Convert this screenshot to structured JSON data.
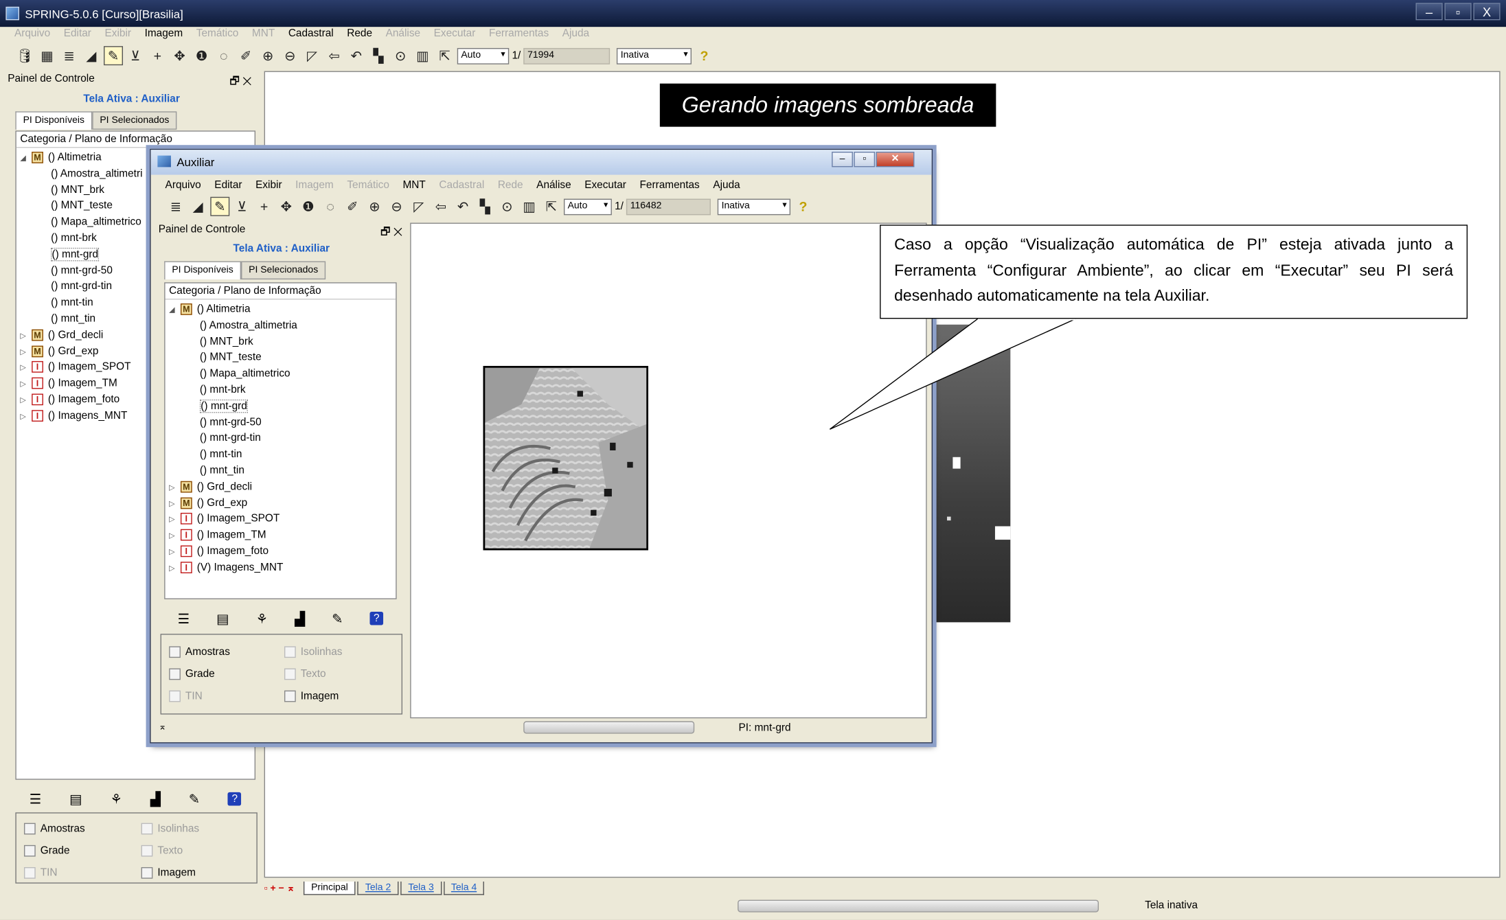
{
  "main": {
    "title": "SPRING-5.0.6 [Curso][Brasilia]",
    "window_buttons": [
      "–",
      "▫",
      "X"
    ],
    "menu": [
      "Arquivo",
      "Editar",
      "Exibir",
      "Imagem",
      "Temático",
      "MNT",
      "Cadastral",
      "Rede",
      "Análise",
      "Executar",
      "Ferramentas",
      "Ajuda"
    ],
    "menu_enabled": [
      false,
      false,
      false,
      true,
      false,
      false,
      true,
      true,
      false,
      false,
      false,
      false
    ],
    "toolbar": {
      "zoom_mode": "Auto",
      "scale_prefix": "1/",
      "scale_value": "71994",
      "state": "Inativa",
      "help": "?"
    },
    "panel": {
      "title": "Painel de Controle",
      "active": "Tela Ativa : Auxiliar",
      "tab_available": "PI Disponíveis",
      "tab_selected": "PI Selecionados",
      "tree_header": "Categoria / Plano de Informação"
    },
    "checks": {
      "amostras": "Amostras",
      "isolinhas": "Isolinhas",
      "grade": "Grade",
      "texto": "Texto",
      "tin": "TIN",
      "imagem": "Imagem"
    },
    "sheet_tabs": [
      "Principal",
      "Tela 2",
      "Tela 3",
      "Tela 4"
    ],
    "status": "Tela inativa"
  },
  "tree": {
    "altimetria": "() Altimetria",
    "children": [
      "() Amostra_altimetria",
      "() MNT_brk",
      "() MNT_teste",
      "() Mapa_altimetrico",
      "() mnt-brk",
      "() mnt-grd",
      "() mnt-grd-50",
      "() mnt-grd-tin",
      "() mnt-tin",
      "() mnt_tin"
    ],
    "main_children": [
      "() Amostra_altimetri",
      "() MNT_brk",
      "() MNT_teste",
      "() Mapa_altimetrico",
      "() mnt-brk",
      "() mnt-grd",
      "() mnt-grd-50",
      "() mnt-grd-tin",
      "() mnt-tin",
      "() mnt_tin"
    ],
    "categories": [
      {
        "badge": "M",
        "label": "() Grd_decli"
      },
      {
        "badge": "M",
        "label": "() Grd_exp"
      },
      {
        "badge": "I",
        "label": "() Imagem_SPOT"
      },
      {
        "badge": "I",
        "label": "() Imagem_TM"
      },
      {
        "badge": "I",
        "label": "() Imagem_foto"
      }
    ],
    "last_main": "() Imagens_MNT",
    "last_aux": "(V) Imagens_MNT"
  },
  "aux": {
    "title": "Auxiliar",
    "menu": [
      "Arquivo",
      "Editar",
      "Exibir",
      "Imagem",
      "Temático",
      "MNT",
      "Cadastral",
      "Rede",
      "Análise",
      "Executar",
      "Ferramentas",
      "Ajuda"
    ],
    "menu_enabled": [
      true,
      true,
      true,
      false,
      false,
      true,
      false,
      false,
      true,
      true,
      true,
      true
    ],
    "scale_value": "116482",
    "status_pi": "PI: mnt-grd"
  },
  "annotation": {
    "caption": "Gerando imagens sombreada",
    "callout": "Caso a opção “Visualização automática de PI” esteja ativada junto a Ferramenta “Configurar Ambiente”, ao clicar em “Executar” seu PI será desenhado automaticamente na tela Auxiliar."
  },
  "colors": {
    "title_bar": "#1b2b52",
    "active_label": "#1f5fc7",
    "callout_bg": "#ffffff",
    "caption_bg": "#000000"
  }
}
